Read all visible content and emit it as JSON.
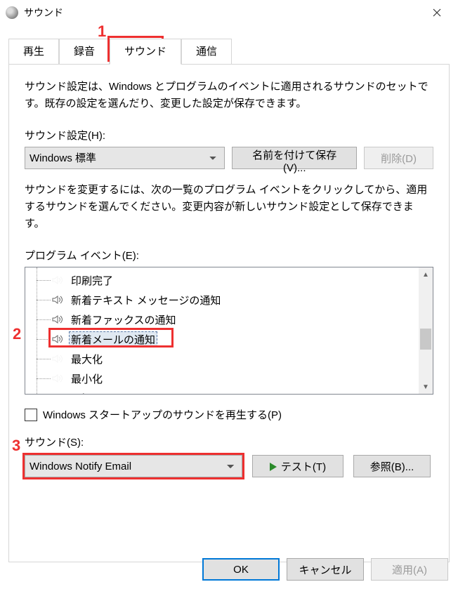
{
  "window": {
    "title": "サウンド"
  },
  "tabs": {
    "playback": "再生",
    "recording": "録音",
    "sounds": "サウンド",
    "communications": "通信"
  },
  "desc": "サウンド設定は、Windows とプログラムのイベントに適用されるサウンドのセットです。既存の設定を選んだり、変更した設定が保存できます。",
  "scheme": {
    "label": "サウンド設定(H):",
    "value": "Windows 標準",
    "saveAs": "名前を付けて保存(V)...",
    "delete": "削除(D)"
  },
  "eventsDesc": "サウンドを変更するには、次の一覧のプログラム イベントをクリックしてから、適用するサウンドを選んでください。変更内容が新しいサウンド設定として保存できます。",
  "events": {
    "label": "プログラム イベント(E):",
    "items": [
      {
        "label": "印刷完了",
        "hasSound": false
      },
      {
        "label": "新着テキスト メッセージの通知",
        "hasSound": true
      },
      {
        "label": "新着ファックスの通知",
        "hasSound": true
      },
      {
        "label": "新着メールの通知",
        "hasSound": true,
        "selected": true
      },
      {
        "label": "最大化",
        "hasSound": false
      },
      {
        "label": "最小化",
        "hasSound": false
      },
      {
        "label": "通知",
        "hasSound": true
      }
    ]
  },
  "startup": {
    "label": "Windows スタートアップのサウンドを再生する(P)"
  },
  "sound": {
    "label": "サウンド(S):",
    "value": "Windows Notify Email",
    "test": "テスト(T)",
    "browse": "参照(B)..."
  },
  "footer": {
    "ok": "OK",
    "cancel": "キャンセル",
    "apply": "適用(A)"
  },
  "annotations": {
    "n1": "1",
    "n2": "2",
    "n3": "3"
  }
}
